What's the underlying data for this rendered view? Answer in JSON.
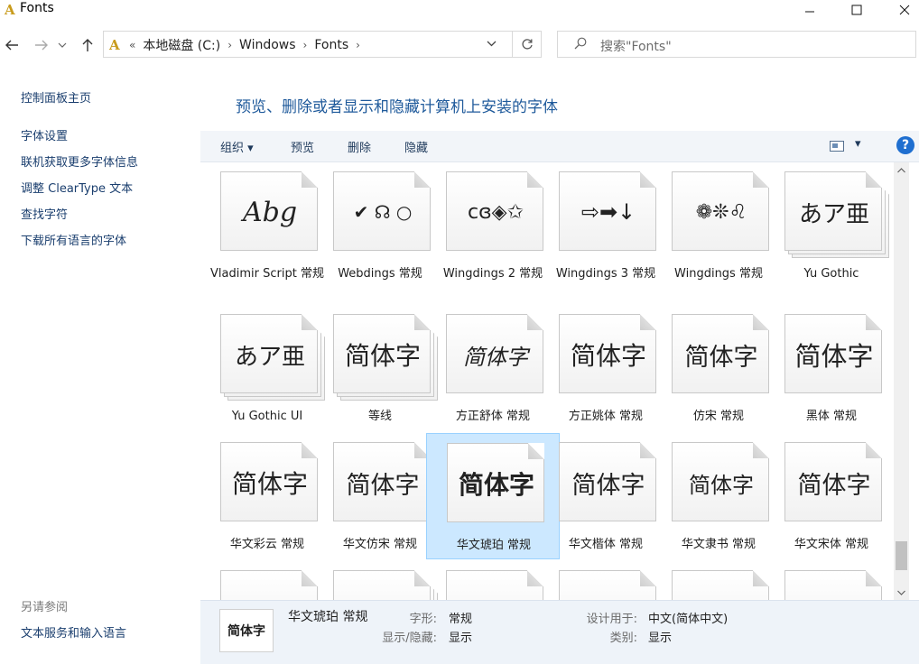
{
  "window": {
    "title": "Fonts",
    "app_icon": "A",
    "minimize_icon": "minimize-icon",
    "maximize_icon": "maximize-icon",
    "close_icon": "close-icon"
  },
  "nav": {
    "crumb_prefix": "«",
    "breadcrumbs": [
      "本地磁盘 (C:)",
      "Windows",
      "Fonts"
    ],
    "search_placeholder": "搜索\"Fonts\""
  },
  "left_pane": {
    "home": "控制面板主页",
    "links": [
      "字体设置",
      "联机获取更多字体信息",
      "调整 ClearType 文本",
      "查找字符",
      "下载所有语言的字体"
    ],
    "see_also_heading": "另请参阅",
    "see_also_links": [
      "文本服务和输入语言"
    ]
  },
  "main": {
    "title": "预览、删除或者显示和隐藏计算机上安装的字体",
    "toolbar": {
      "organize": "组织",
      "organize_arrow": "▾",
      "preview": "预览",
      "delete": "删除",
      "hide": "隐藏",
      "view_arrow": "▾",
      "help": "?"
    }
  },
  "fonts": [
    {
      "label": "Vladimir Script 常规",
      "sample": "Abg",
      "family": "DejaVu Serif",
      "style": "italic",
      "size": 30,
      "stack": false
    },
    {
      "label": "Webdings 常规",
      "sample": "✔ ☊ ○",
      "family": "DejaVu Sans",
      "style": "normal",
      "size": 20,
      "stack": false
    },
    {
      "label": "Wingdings 2 常规",
      "sample": "ᴄɞ◈✩",
      "family": "DejaVu Sans",
      "style": "normal",
      "size": 22,
      "stack": false
    },
    {
      "label": "Wingdings 3 常规",
      "sample": "⇨➡↓",
      "family": "DejaVu Sans",
      "style": "normal",
      "size": 24,
      "stack": false
    },
    {
      "label": "Wingdings 常规",
      "sample": "❁❊♌",
      "family": "DejaVu Sans",
      "style": "normal",
      "size": 22,
      "stack": false
    },
    {
      "label": "Yu Gothic",
      "sample": "あア亜",
      "family": "DejaVu Sans",
      "style": "normal",
      "size": 26,
      "stack": true
    },
    {
      "label": "Yu Gothic UI",
      "sample": "あア亜",
      "family": "DejaVu Sans",
      "style": "normal",
      "size": 26,
      "stack": true
    },
    {
      "label": "等线",
      "sample": "简体字",
      "family": "DejaVu Sans",
      "style": "normal",
      "size": 28,
      "stack": true
    },
    {
      "label": "方正舒体 常规",
      "sample": "简体字",
      "family": "DejaVu Serif",
      "style": "italic",
      "size": 24,
      "stack": false
    },
    {
      "label": "方正姚体 常规",
      "sample": "简体字",
      "family": "DejaVu Sans",
      "style": "normal",
      "size": 28,
      "stack": false
    },
    {
      "label": "仿宋 常规",
      "sample": "简体字",
      "family": "DejaVu Serif",
      "style": "normal",
      "size": 27,
      "stack": false
    },
    {
      "label": "黑体 常规",
      "sample": "简体字",
      "family": "DejaVu Sans",
      "style": "normal",
      "size": 29,
      "stack": false
    },
    {
      "label": "华文彩云 常规",
      "sample": "简体字",
      "family": "DejaVu Sans",
      "style": "normal",
      "size": 28,
      "stack": false
    },
    {
      "label": "华文仿宋 常规",
      "sample": "简体字",
      "family": "DejaVu Serif",
      "style": "normal",
      "size": 27,
      "stack": false
    },
    {
      "label": "华文琥珀 常规",
      "sample": "简体字",
      "family": "DejaVu Sans",
      "style": "normal",
      "size": 28,
      "stack": false,
      "selected": true
    },
    {
      "label": "华文楷体 常规",
      "sample": "简体字",
      "family": "DejaVu Serif",
      "style": "normal",
      "size": 27,
      "stack": false
    },
    {
      "label": "华文隶书 常规",
      "sample": "简体字",
      "family": "DejaVu Serif",
      "style": "normal",
      "size": 24,
      "stack": false
    },
    {
      "label": "华文宋体 常规",
      "sample": "简体字",
      "family": "DejaVu Serif",
      "style": "normal",
      "size": 27,
      "stack": false
    },
    {
      "label": "",
      "sample": "",
      "family": "DejaVu Sans",
      "style": "normal",
      "size": 20,
      "stack": false
    },
    {
      "label": "",
      "sample": "",
      "family": "DejaVu Sans",
      "style": "normal",
      "size": 20,
      "stack": true
    },
    {
      "label": "",
      "sample": "",
      "family": "DejaVu Sans",
      "style": "normal",
      "size": 20,
      "stack": false
    },
    {
      "label": "",
      "sample": "",
      "family": "DejaVu Sans",
      "style": "normal",
      "size": 20,
      "stack": false
    },
    {
      "label": "",
      "sample": "",
      "family": "DejaVu Sans",
      "style": "normal",
      "size": 20,
      "stack": false
    },
    {
      "label": "",
      "sample": "",
      "family": "DejaVu Sans",
      "style": "normal",
      "size": 20,
      "stack": false
    }
  ],
  "details": {
    "thumb_sample": "简体字",
    "name": "华文琥珀 常规",
    "style_key": "字形:",
    "style_val": "常规",
    "show_key": "显示/隐藏:",
    "show_val": "显示",
    "design_key": "设计用于:",
    "design_val": "中文(简体中文)",
    "category_key": "类别:",
    "category_val": "显示"
  },
  "colors": {
    "accent": "#1f5a9b",
    "selection": "#cce8ff",
    "help": "#1f6fd0"
  }
}
